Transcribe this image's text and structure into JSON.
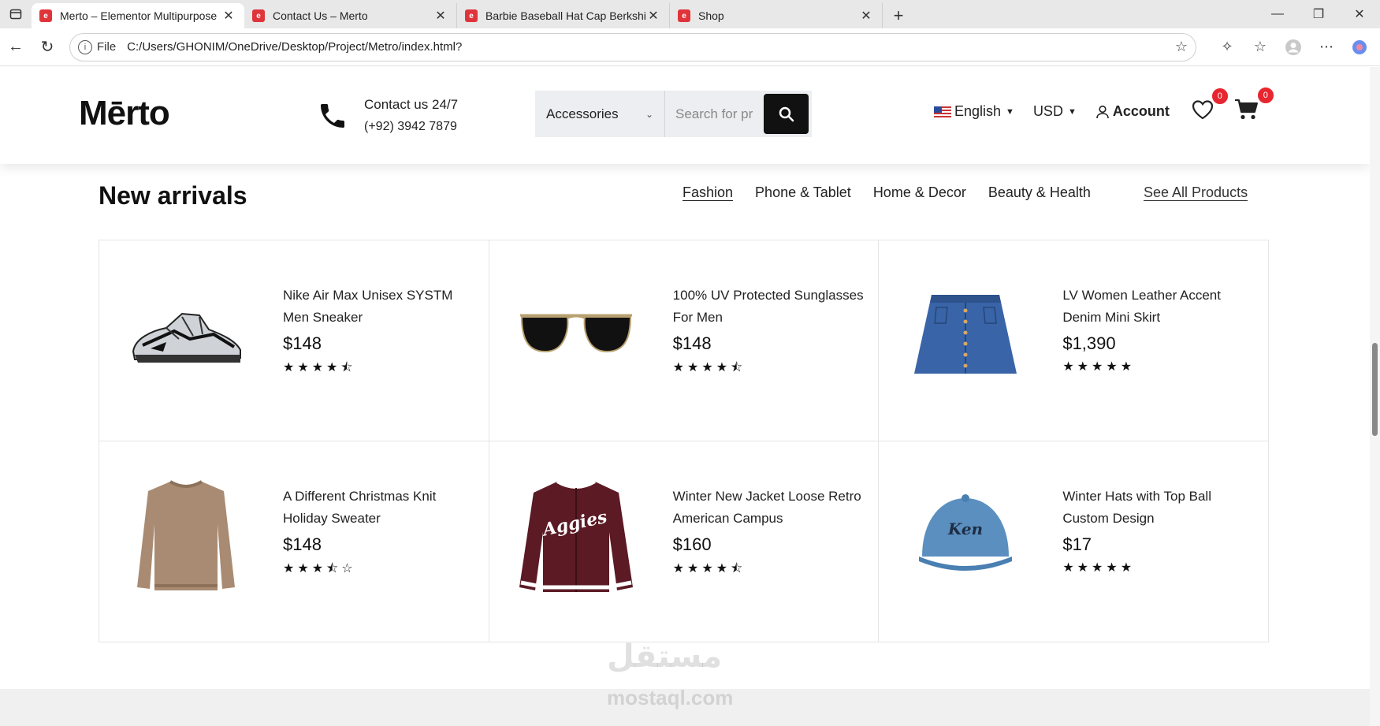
{
  "browser": {
    "tabs": [
      {
        "title": "Merto – Elementor Multipurpose",
        "active": true
      },
      {
        "title": "Contact Us – Merto",
        "active": false
      },
      {
        "title": "Barbie Baseball Hat Cap Berkshire",
        "active": false
      },
      {
        "title": "Shop",
        "active": false
      }
    ],
    "file_label": "File",
    "url": "C:/Users/GHONIM/OneDrive/Desktop/Project/Metro/index.html?"
  },
  "header": {
    "logo": "Mērto",
    "contact_line1": "Contact us 24/7",
    "contact_line2": "(+92) 3942 7879",
    "search_category": "Accessories",
    "search_placeholder": "Search for pr",
    "language": "English",
    "currency": "USD",
    "account": "Account",
    "wishlist_count": "0",
    "cart_count": "0"
  },
  "section": {
    "title": "New arrivals",
    "tabs": [
      "Fashion",
      "Phone & Tablet",
      "Home & Decor",
      "Beauty & Health"
    ],
    "see_all": "See All Products"
  },
  "products": [
    {
      "name": "Nike Air Max Unisex SYSTM Men Sneaker",
      "price": "$148",
      "rating": 4.5,
      "image": "sneaker-image"
    },
    {
      "name": "100% UV Protected Sunglasses For Men",
      "price": "$148",
      "rating": 4.5,
      "image": "sunglasses-image"
    },
    {
      "name": "LV Women Leather Accent Denim Mini Skirt",
      "price": "$1,390",
      "rating": 5,
      "image": "skirt-image"
    },
    {
      "name": "A Different Christmas Knit Holiday Sweater",
      "price": "$148",
      "rating": 3.5,
      "image": "sweater-image"
    },
    {
      "name": "Winter New Jacket Loose Retro American Campus",
      "price": "$160",
      "rating": 4.5,
      "image": "jacket-image"
    },
    {
      "name": "Winter Hats with Top Ball Custom Design",
      "price": "$17",
      "rating": 5,
      "image": "cap-image"
    }
  ],
  "watermark": {
    "arabic": "مستقل",
    "latin": "mostaql.com"
  }
}
